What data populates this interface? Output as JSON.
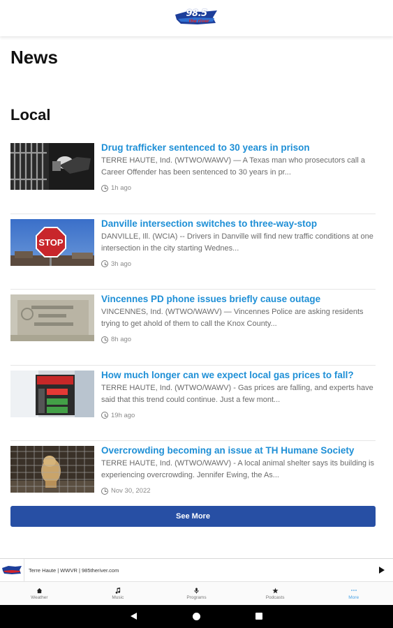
{
  "header": {
    "logo_primary": "98.5",
    "logo_secondary": "the river"
  },
  "page": {
    "title": "News",
    "section_title": "Local"
  },
  "articles": [
    {
      "title": "Drug trafficker sentenced to 30 years in prison",
      "summary": "TERRE HAUTE, Ind. (WTWO/WAWV) — A Texas man who prosecutors call a Career Offender has been sentenced to 30 years in pr...",
      "time": "1h ago",
      "image": "jail-bars-photo"
    },
    {
      "title": "Danville intersection switches to three-way-stop",
      "summary": "DANVILLE, Ill. (WCIA) -- Drivers in Danville will find new traffic conditions at one intersection in the city starting Wednes...",
      "time": "3h ago",
      "image": "stop-sign-photo",
      "image_text": "STOP"
    },
    {
      "title": "Vincennes PD phone issues briefly cause outage",
      "summary": "VINCENNES, Ind. (WTWO/WAWV) — Vincennes Police are asking residents trying to get ahold of them to call the Knox County...",
      "time": "8h ago",
      "image": "police-department-sign-photo"
    },
    {
      "title": "How much longer can we expect local gas prices to fall?",
      "summary": "TERRE HAUTE, Ind. (WTWO/WAWV) - Gas prices are falling, and experts have said that this trend could continue. Just a few mont...",
      "time": "19h ago",
      "image": "gas-price-sign-photo"
    },
    {
      "title": "Overcrowding becoming an issue at TH Humane Society",
      "summary": "TERRE HAUTE, Ind. (WTWO/WAWV) - A local animal shelter says its building is experiencing overcrowding. Jennifer Ewing, the As...",
      "time": "Nov 30, 2022",
      "image": "dog-in-kennel-photo"
    }
  ],
  "see_more_label": "See More",
  "player": {
    "station_label": "Terre Haute | WWVR | 985theriver.com",
    "play_icon": "play-icon"
  },
  "tabs": [
    {
      "label": "Weather",
      "icon": "home-icon",
      "active": false
    },
    {
      "label": "Music",
      "icon": "music-note-icon",
      "active": false
    },
    {
      "label": "Programs",
      "icon": "microphone-icon",
      "active": false
    },
    {
      "label": "Podcasts",
      "icon": "star-icon",
      "active": false
    },
    {
      "label": "More",
      "icon": "more-dots-icon",
      "active": true
    }
  ],
  "colors": {
    "accent_blue": "#1e8fd6",
    "button_blue": "#274fa4",
    "active_tab": "#4aa3e6"
  }
}
